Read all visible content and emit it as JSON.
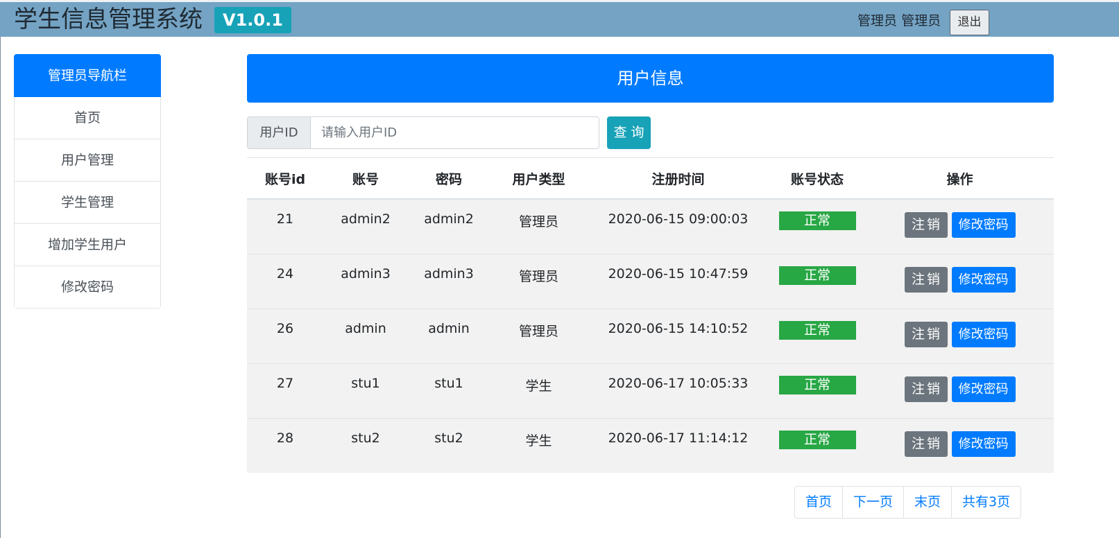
{
  "header": {
    "title": "学生信息管理系统",
    "version": "V1.0.1",
    "user_role": "管理员",
    "user_name": "管理员",
    "logout_label": "退出"
  },
  "sidebar": {
    "title": "管理员导航栏",
    "items": [
      {
        "label": "首页"
      },
      {
        "label": "用户管理"
      },
      {
        "label": "学生管理"
      },
      {
        "label": "增加学生用户"
      },
      {
        "label": "修改密码"
      }
    ]
  },
  "main": {
    "title": "用户信息",
    "search": {
      "label": "用户ID",
      "placeholder": "请输入用户ID",
      "value": "",
      "button_label": "查 询"
    },
    "table": {
      "columns": [
        "账号id",
        "账号",
        "密码",
        "用户类型",
        "注册时间",
        "账号状态",
        "操作"
      ],
      "rows": [
        {
          "id": "21",
          "account": "admin2",
          "password": "admin2",
          "type": "管理员",
          "registered": "2020-06-15 09:00:03",
          "status": "正常"
        },
        {
          "id": "24",
          "account": "admin3",
          "password": "admin3",
          "type": "管理员",
          "registered": "2020-06-15 10:47:59",
          "status": "正常"
        },
        {
          "id": "26",
          "account": "admin",
          "password": "admin",
          "type": "管理员",
          "registered": "2020-06-15 14:10:52",
          "status": "正常"
        },
        {
          "id": "27",
          "account": "stu1",
          "password": "stu1",
          "type": "学生",
          "registered": "2020-06-17 10:05:33",
          "status": "正常"
        },
        {
          "id": "28",
          "account": "stu2",
          "password": "stu2",
          "type": "学生",
          "registered": "2020-06-17 11:14:12",
          "status": "正常"
        }
      ],
      "cancel_label": "注销",
      "change_password_label": "修改密码"
    },
    "pagination": {
      "first": "首页",
      "next": "下一页",
      "last": "末页",
      "total": "共有3页"
    }
  },
  "colors": {
    "topbar": "#74a3c4",
    "primary": "#007bff",
    "info": "#17a2b8",
    "success": "#28a745",
    "secondary": "#6c757d"
  }
}
